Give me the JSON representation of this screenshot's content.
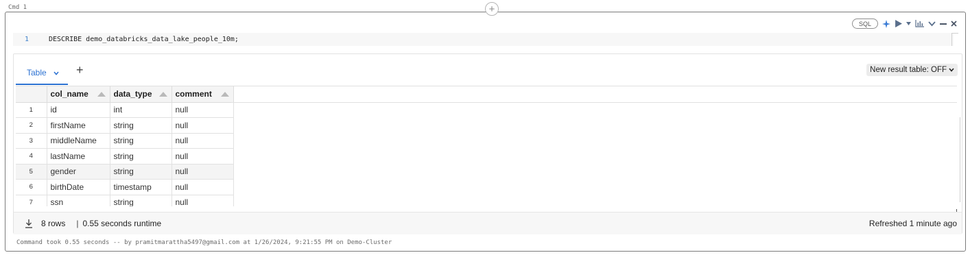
{
  "cell": {
    "label": "Cmd 1",
    "add_symbol": "+",
    "language_badge": "SQL",
    "toolbar_icons": [
      "assistant-sparkle-icon",
      "run-icon",
      "chevron-down-icon",
      "chart-icon",
      "chevron-down-icon",
      "minimize-icon",
      "close-icon"
    ]
  },
  "editor": {
    "line_number": "1",
    "code": "DESCRIBE demo_databricks_data_lake_people_10m;"
  },
  "results": {
    "tab_label": "Table",
    "add_tab_symbol": "+",
    "new_result_toggle": "New result table: OFF",
    "columns": [
      "col_name",
      "data_type",
      "comment"
    ],
    "rows": [
      {
        "n": "1",
        "col_name": "id",
        "data_type": "int",
        "comment": "null"
      },
      {
        "n": "2",
        "col_name": "firstName",
        "data_type": "string",
        "comment": "null"
      },
      {
        "n": "3",
        "col_name": "middleName",
        "data_type": "string",
        "comment": "null"
      },
      {
        "n": "4",
        "col_name": "lastName",
        "data_type": "string",
        "comment": "null"
      },
      {
        "n": "5",
        "col_name": "gender",
        "data_type": "string",
        "comment": "null"
      },
      {
        "n": "6",
        "col_name": "birthDate",
        "data_type": "timestamp",
        "comment": "null"
      },
      {
        "n": "7",
        "col_name": "ssn",
        "data_type": "string",
        "comment": "null"
      }
    ],
    "footer": {
      "rows": "8 rows",
      "separator": "|",
      "runtime": "0.55 seconds runtime",
      "refreshed": "Refreshed 1 minute ago"
    }
  },
  "status_line": "Command took 0.55 seconds -- by pramitmarattha5497@gmail.com at 1/26/2024, 9:21:55 PM on Demo-Cluster"
}
